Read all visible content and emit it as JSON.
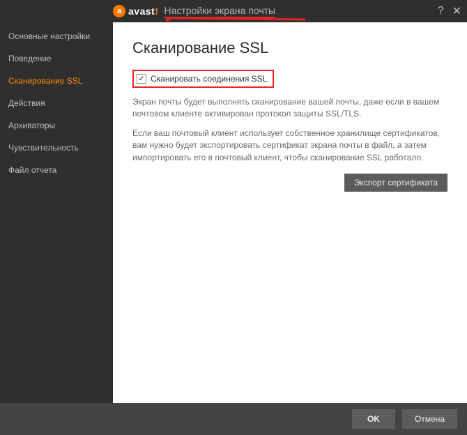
{
  "titlebar": {
    "logo_text": "avast",
    "logo_bang": "!",
    "title": "Настройки экрана почты",
    "help_glyph": "?",
    "close_glyph": "✕"
  },
  "sidebar": {
    "items": [
      {
        "label": "Основные настройки",
        "active": false
      },
      {
        "label": "Поведение",
        "active": false
      },
      {
        "label": "Сканирование SSL",
        "active": true
      },
      {
        "label": "Действия",
        "active": false
      },
      {
        "label": "Архиваторы",
        "active": false
      },
      {
        "label": "Чувствительность",
        "active": false
      },
      {
        "label": "Файл отчета",
        "active": false
      }
    ]
  },
  "main": {
    "heading": "Сканирование SSL",
    "checkbox": {
      "checked": true,
      "check_glyph": "✓",
      "label": "Сканировать соединения SSL"
    },
    "paragraph1": "Экран почты будет выполнять сканирование вашей почты, даже если в вашем почтовом клиенте активирован протокол защиты SSL/TLS.",
    "paragraph2": "Если ваш почтовый клиент использует собственное хранилище сертификатов, вам нужно будет экспортировать сертификат экрана почты в файл, а затем импортировать его в почтовый клиент, чтобы сканирование SSL работало.",
    "export_button": "Экспорт сертификата"
  },
  "footer": {
    "ok_label": "OK",
    "cancel_label": "Отмена"
  },
  "colors": {
    "accent_orange": "#ff7800",
    "annotation_red": "#e22222",
    "sidebar_bg": "#2f2f2f",
    "content_bg": "#ffffff",
    "footer_bg": "#444444",
    "btn_bg": "#5c5c5c"
  }
}
